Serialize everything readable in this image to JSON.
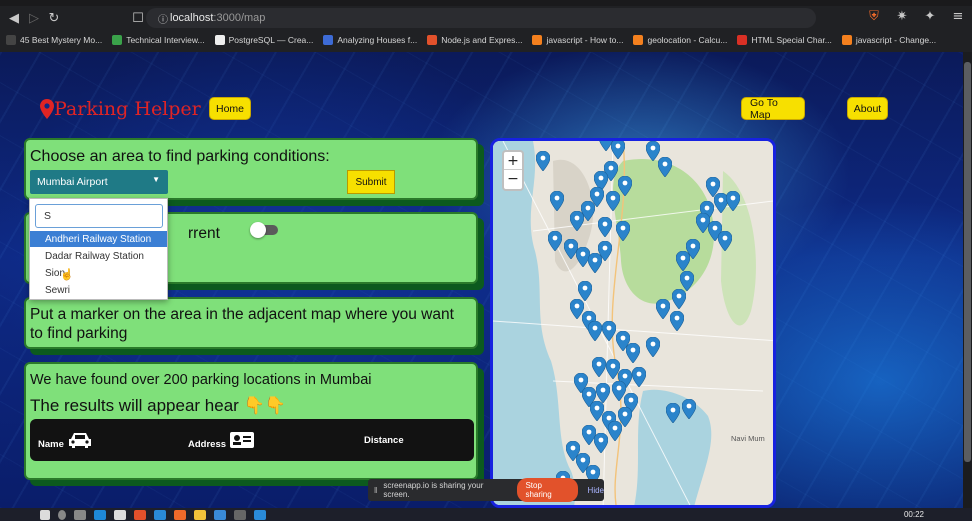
{
  "browser": {
    "url_host": "localhost",
    "url_path": ":3000/map",
    "bookmarks": [
      "45 Best Mystery Mo...",
      "Technical Interview...",
      "PostgreSQL — Crea...",
      "Analyzing Houses f...",
      "Node.js and Expres...",
      "javascript - How to...",
      "geolocation - Calcu...",
      "HTML Special Char...",
      "javascript - Change..."
    ]
  },
  "header": {
    "brand_icon": "map-pin-icon",
    "brand": "Parking Helper",
    "home": "Home",
    "go_to_map": "Go To Map",
    "about": "About"
  },
  "area_card": {
    "title": "Choose an area to find parking conditions:",
    "selected": "Mumbai Airport",
    "submit": "Submit"
  },
  "dropdown": {
    "search_value": "S",
    "options": [
      "Andheri Railway Station",
      "Dadar Railway Station",
      "Sion",
      "Sewri"
    ],
    "highlighted_index": 0
  },
  "location_card": {
    "visible_text": "rrent"
  },
  "marker_card": {
    "text": "Put a marker on the area in the adjacent map where you want to find parking"
  },
  "results_card": {
    "found": "We have found over 200 parking locations in Mumbai",
    "results_text": "The results will appear hear 👇👇",
    "columns": [
      "Name",
      "Address",
      "Distance"
    ],
    "column_icons": [
      "car-icon",
      "id-card-icon",
      ""
    ]
  },
  "map": {
    "zoom_in": "+",
    "zoom_out": "−",
    "place_label": "Navi Mum",
    "marker_color": "#2b84cb"
  },
  "screen_share": {
    "message": "screenapp.io is sharing your screen.",
    "stop": "Stop sharing",
    "hide": "Hide"
  },
  "taskbar": {
    "time": "00:22"
  }
}
